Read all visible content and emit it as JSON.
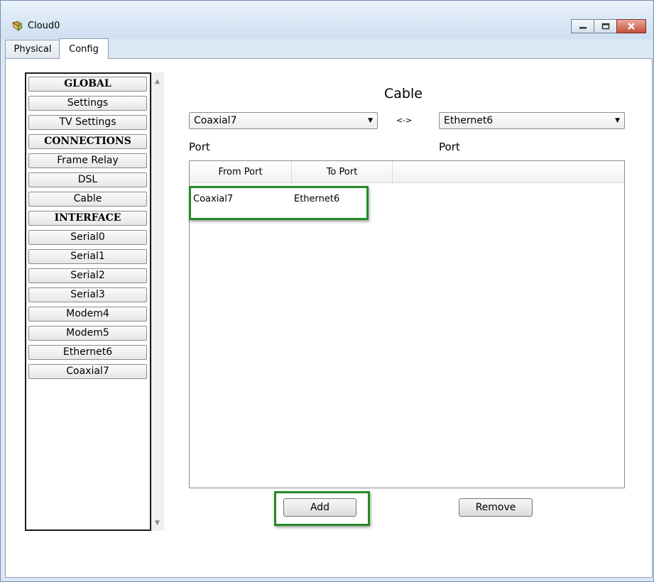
{
  "window": {
    "title": "Cloud0"
  },
  "tabs": [
    {
      "label": "Physical"
    },
    {
      "label": "Config"
    }
  ],
  "sidebar": {
    "items": [
      {
        "label": "GLOBAL",
        "header": true
      },
      {
        "label": "Settings"
      },
      {
        "label": "TV Settings"
      },
      {
        "label": "CONNECTIONS",
        "header": true
      },
      {
        "label": "Frame Relay"
      },
      {
        "label": "DSL"
      },
      {
        "label": "Cable"
      },
      {
        "label": "INTERFACE",
        "header": true
      },
      {
        "label": "Serial0"
      },
      {
        "label": "Serial1"
      },
      {
        "label": "Serial2"
      },
      {
        "label": "Serial3"
      },
      {
        "label": "Modem4"
      },
      {
        "label": "Modem5"
      },
      {
        "label": "Ethernet6"
      },
      {
        "label": "Coaxial7"
      }
    ]
  },
  "main": {
    "title": "Cable",
    "link_symbol": "<->",
    "from_select": "Coaxial7",
    "to_select": "Ethernet6",
    "from_port_label": "Port",
    "to_port_label": "Port",
    "table": {
      "headers": [
        "From Port",
        "To Port"
      ],
      "rows": [
        [
          "Coaxial7",
          "Ethernet6"
        ]
      ]
    },
    "add_label": "Add",
    "remove_label": "Remove"
  },
  "colors": {
    "highlight": "#258b25",
    "titlebar": "#cfdff1",
    "close": "#c4503a"
  }
}
